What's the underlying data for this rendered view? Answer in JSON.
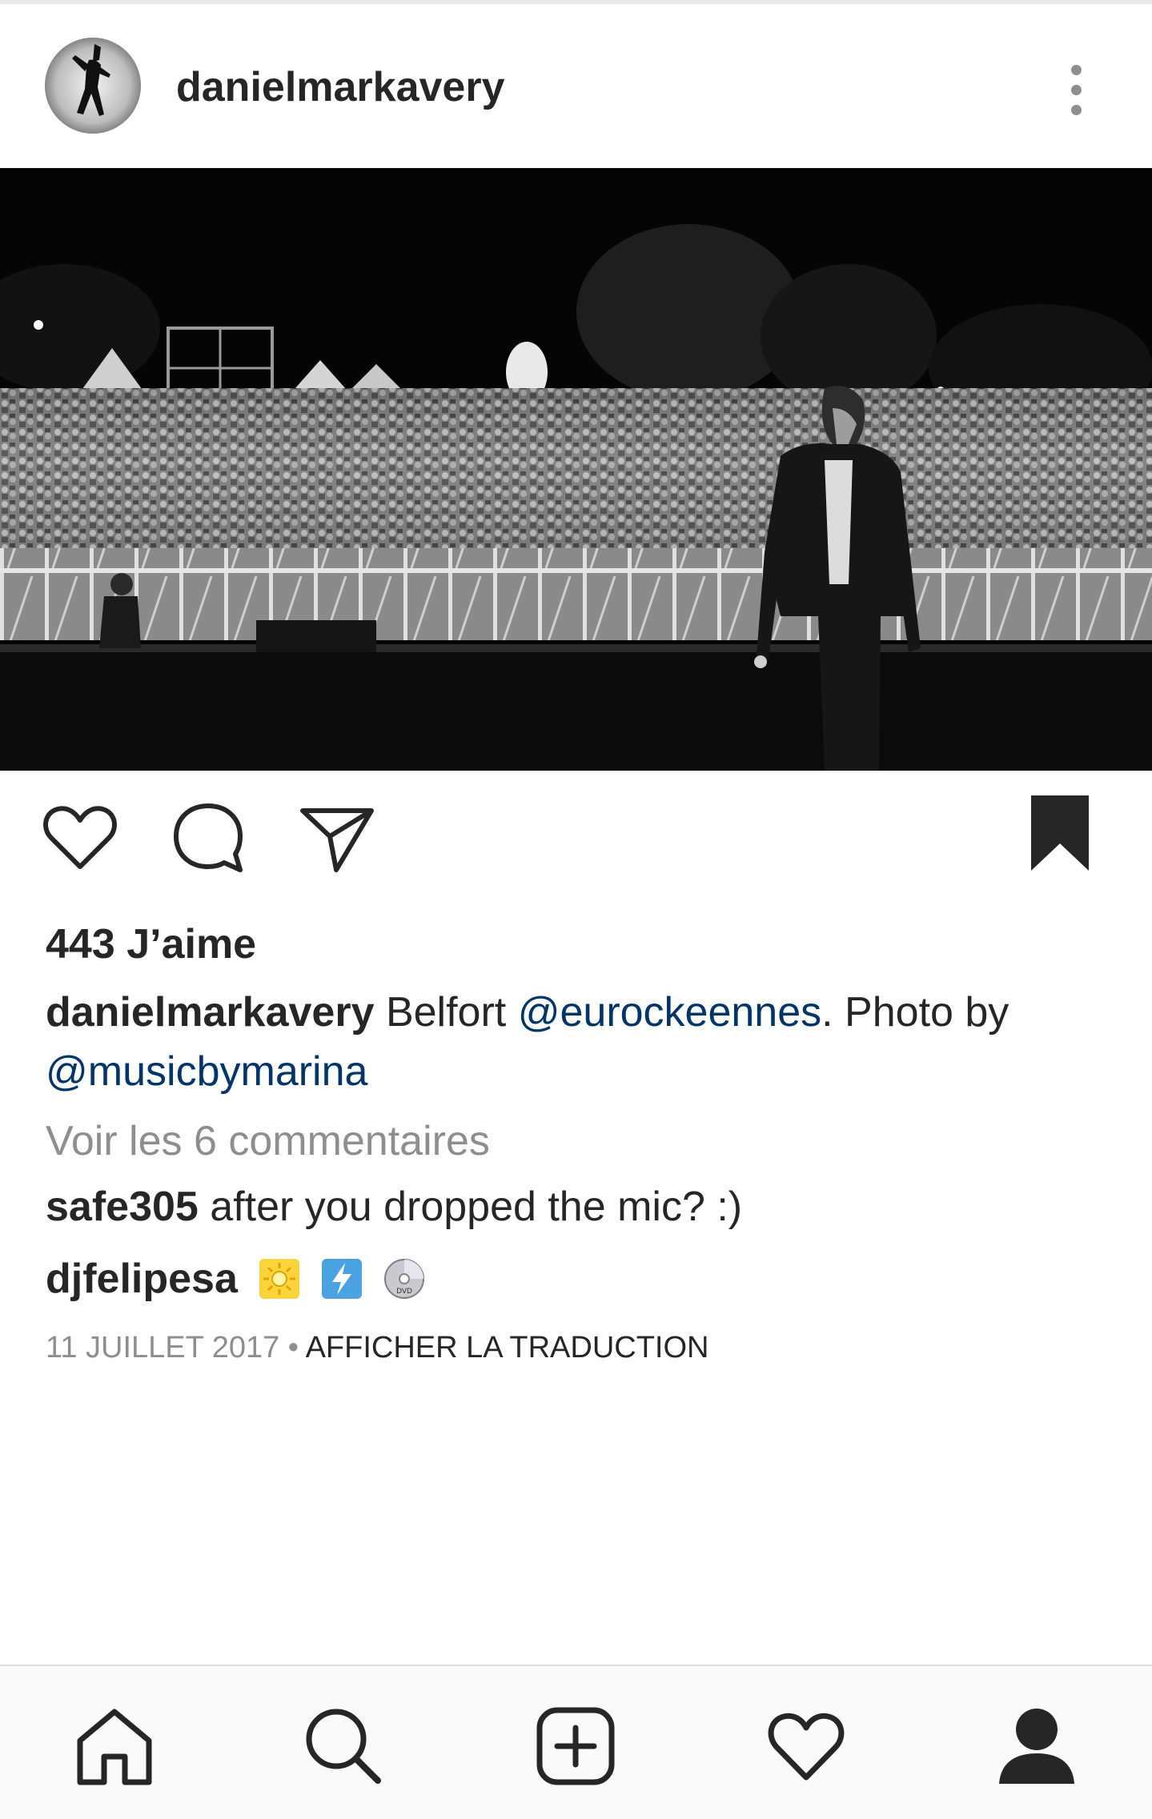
{
  "post": {
    "username": "danielmarkavery",
    "likes": "443 J’aime",
    "caption": {
      "author": "danielmarkavery",
      "text_before": " Belfort ",
      "mention_1": "@eurockeennes",
      "text_middle": ". Photo by ",
      "mention_2": "@musicbymarina"
    },
    "view_comments": "Voir les 6 commentaires",
    "comments": [
      {
        "user": "safe305",
        "text": " after you dropped the mic? :)"
      },
      {
        "user": "djfelipesa",
        "emojis": [
          "sun-emoji",
          "high-voltage-emoji",
          "dvd-emoji"
        ],
        "dvd_label": "DVD"
      }
    ],
    "date": "11 JUILLET 2017",
    "separator": " • ",
    "translate_label": "AFFICHER LA TRADUCTION"
  },
  "icons": {
    "more": "more-vertical-icon",
    "like": "heart-outline-icon",
    "comment": "comment-icon",
    "share": "paper-plane-icon",
    "save": "bookmark-filled-icon"
  },
  "bottom_nav": [
    "home-icon",
    "search-icon",
    "add-post-icon",
    "activity-heart-icon",
    "profile-icon"
  ],
  "colors": {
    "text": "#262626",
    "secondary": "#8e8e8e",
    "mention": "#003569",
    "nav_background": "#fafafa"
  }
}
